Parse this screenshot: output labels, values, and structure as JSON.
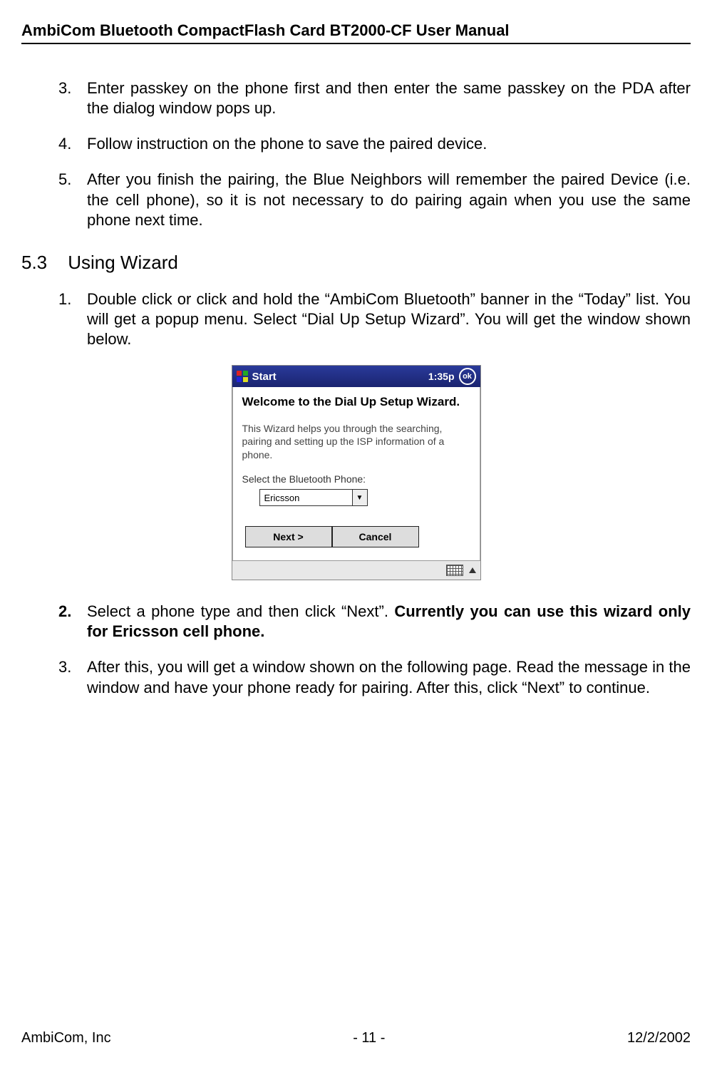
{
  "header": "AmbiCom Bluetooth CompactFlash Card BT2000-CF User Manual",
  "items_a": [
    {
      "num": "3.",
      "text": "Enter passkey on the phone first and then enter the same passkey on the PDA after the dialog window pops up."
    },
    {
      "num": "4.",
      "text": "Follow instruction on the phone to save the paired device."
    },
    {
      "num": "5.",
      "text": "After you finish the pairing, the Blue Neighbors will remember the paired Device (i.e. the cell phone), so it is not necessary to do pairing again when you use the same phone next time."
    }
  ],
  "section": {
    "num": "5.3",
    "title": "Using Wizard"
  },
  "items_b": [
    {
      "num": "1.",
      "text": "Double click or click and hold the “AmbiCom Bluetooth” banner in the “Today” list. You will get a popup menu. Select “Dial Up Setup Wizard”. You will get the window shown below."
    }
  ],
  "pda": {
    "title": "Start",
    "time": "1:35p",
    "ok": "ok",
    "welcome": "Welcome to the Dial Up Setup Wizard.",
    "desc": "This Wizard helps you through the searching, pairing and setting up the ISP information of a phone.",
    "select_label": "Select the Bluetooth Phone:",
    "dropdown_value": "Ericsson",
    "next_btn": "Next >",
    "cancel_btn": "Cancel"
  },
  "items_c_2": {
    "num": "2.",
    "lead": "Select a phone type and then click “Next”. ",
    "bold": "Currently you can use this wizard only for Ericsson cell phone."
  },
  "items_c_3": {
    "num": "3.",
    "text": "After this, you will get a window shown on the following page. Read the message in the window and have your phone ready for pairing.  After this, click “Next” to continue."
  },
  "footer": {
    "left": "AmbiCom, Inc",
    "center": "- 11 -",
    "right": "12/2/2002"
  }
}
